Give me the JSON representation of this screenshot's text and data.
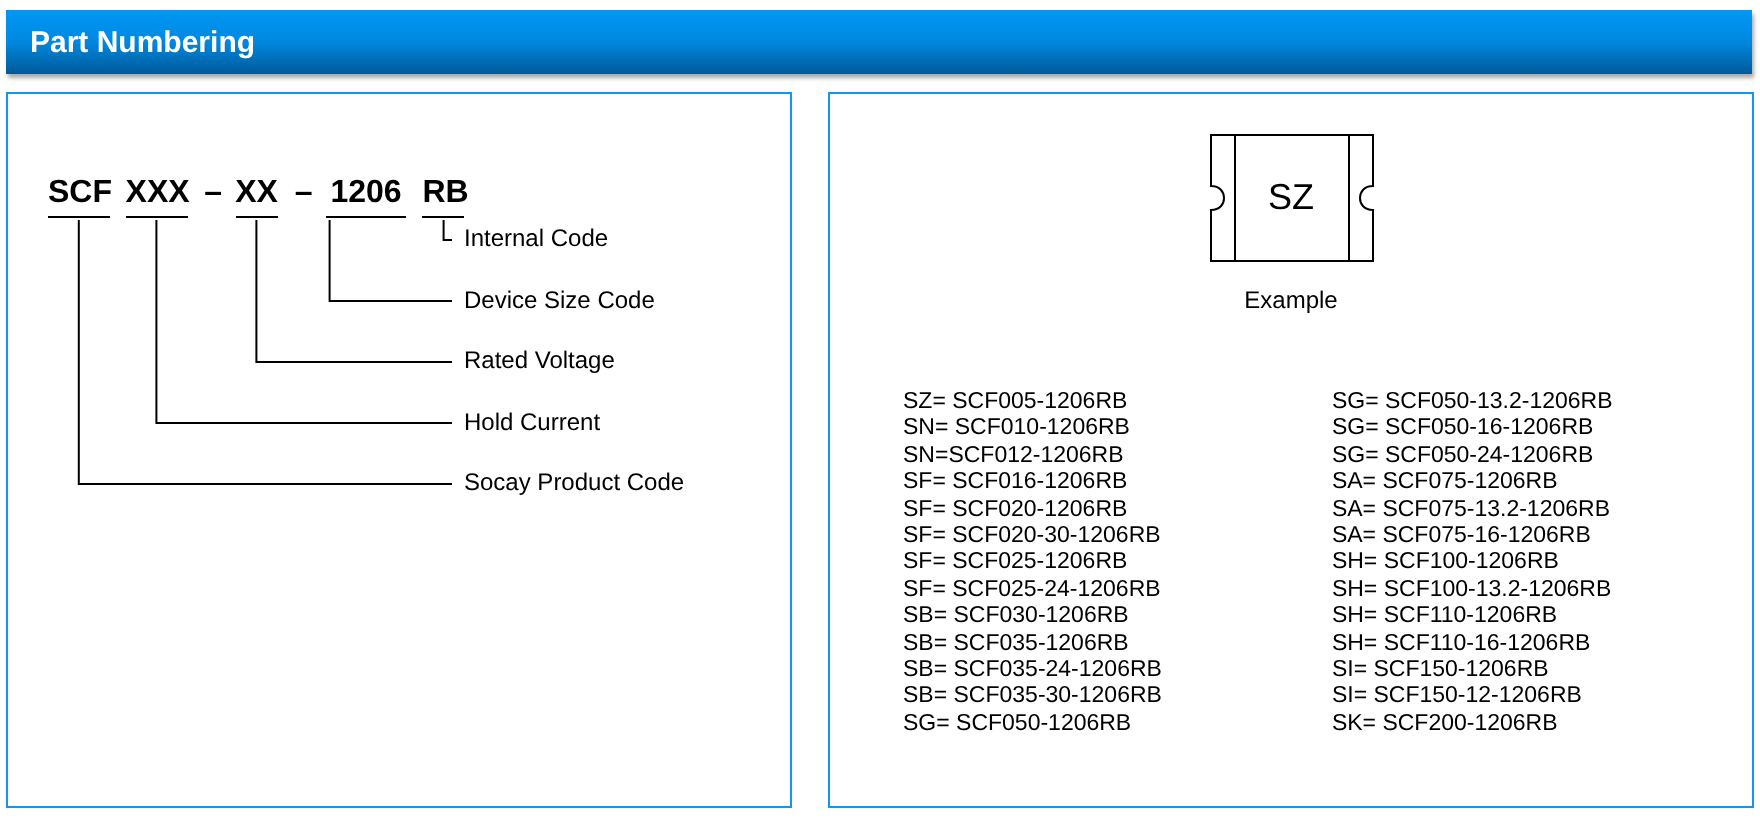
{
  "header": {
    "title": "Part Numbering"
  },
  "part_number": {
    "segments": [
      {
        "kind": "field",
        "text": "SCF"
      },
      {
        "kind": "field",
        "text": "XXX"
      },
      {
        "kind": "separator",
        "text": "–"
      },
      {
        "kind": "field",
        "text": "XX"
      },
      {
        "kind": "separator",
        "text": "–"
      },
      {
        "kind": "field",
        "text": "1206"
      },
      {
        "kind": "field",
        "text": "RB"
      }
    ],
    "labels": [
      "Internal Code",
      "Device Size Code",
      "Rated Voltage",
      "Hold Current",
      "Socay Product Code"
    ]
  },
  "example": {
    "marking": "SZ",
    "caption": "Example"
  },
  "codes": [
    [
      "SZ= SCF005-1206RB",
      "SN= SCF010-1206RB",
      "SN=SCF012-1206RB",
      "SF= SCF016-1206RB",
      "SF= SCF020-1206RB",
      "SF= SCF020-30-1206RB",
      "SF= SCF025-1206RB",
      "SF= SCF025-24-1206RB",
      "SB= SCF030-1206RB",
      "SB= SCF035-1206RB",
      "SB= SCF035-24-1206RB",
      "SB= SCF035-30-1206RB",
      "SG= SCF050-1206RB"
    ],
    [
      "SG= SCF050-13.2-1206RB",
      "SG= SCF050-16-1206RB",
      "SG= SCF050-24-1206RB",
      "SA= SCF075-1206RB",
      "SA= SCF075-13.2-1206RB",
      "SA= SCF075-16-1206RB",
      "SH= SCF100-1206RB",
      "SH= SCF100-13.2-1206RB",
      "SH= SCF110-1206RB",
      "SH= SCF110-16-1206RB",
      "SI= SCF150-1206RB",
      "SI= SCF150-12-1206RB",
      "SK= SCF200-1206RB"
    ]
  ]
}
